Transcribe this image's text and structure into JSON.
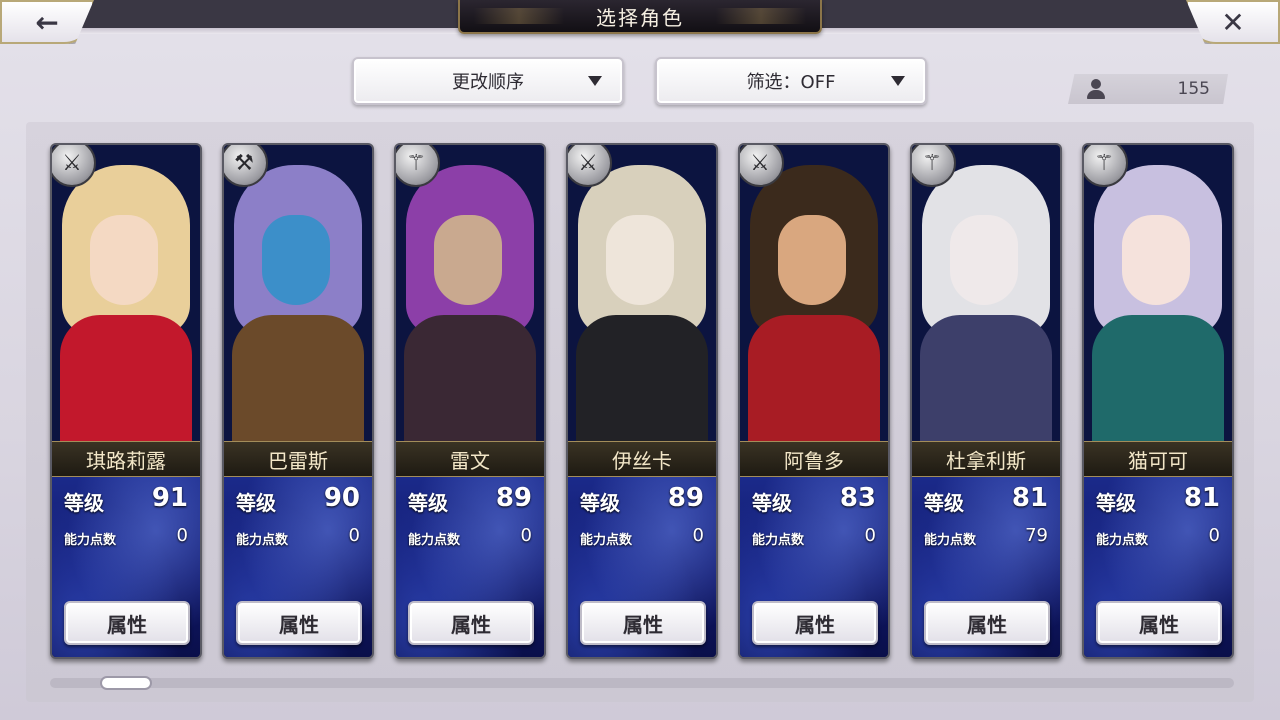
{
  "header": {
    "title": "选择角色",
    "back_icon": "←",
    "close_icon": "✕"
  },
  "controls": {
    "sort_label": "更改顺序",
    "filter_label": "筛选：OFF",
    "character_count": "155"
  },
  "card_labels": {
    "level": "等级",
    "ability_points": "能力点数",
    "attribute_button": "属性"
  },
  "characters": [
    {
      "name": "琪路莉露",
      "level": "91",
      "ability_points": "0",
      "weapon": "sword-icon",
      "weapon_glyph": "⚔",
      "hair": "#e9cf9a",
      "face": "#f4d9c3",
      "body": "#c2182c"
    },
    {
      "name": "巴雷斯",
      "level": "90",
      "ability_points": "0",
      "weapon": "axe-icon",
      "weapon_glyph": "⚒",
      "hair": "#8c7fc8",
      "face": "#3c8fc9",
      "body": "#6b4a2a"
    },
    {
      "name": "雷文",
      "level": "89",
      "ability_points": "0",
      "weapon": "staff-icon",
      "weapon_glyph": "⚚",
      "hair": "#8c3fa8",
      "face": "#c9a98f",
      "body": "#3a2834"
    },
    {
      "name": "伊丝卡",
      "level": "89",
      "ability_points": "0",
      "weapon": "blade-icon",
      "weapon_glyph": "⚔",
      "hair": "#d8d0bc",
      "face": "#eee5da",
      "body": "#222226"
    },
    {
      "name": "阿鲁多",
      "level": "83",
      "ability_points": "0",
      "weapon": "sword-icon",
      "weapon_glyph": "⚔",
      "hair": "#3b2a1c",
      "face": "#d9a77f",
      "body": "#a81c24"
    },
    {
      "name": "杜拿利斯",
      "level": "81",
      "ability_points": "79",
      "weapon": "staff-icon",
      "weapon_glyph": "⚚",
      "hair": "#e2e2e6",
      "face": "#efe9ea",
      "body": "#3d3f6a"
    },
    {
      "name": "猫可可",
      "level": "81",
      "ability_points": "0",
      "weapon": "staff-icon",
      "weapon_glyph": "⚚",
      "hair": "#c8c0e0",
      "face": "#f5e2dc",
      "body": "#1f6a6a"
    }
  ]
}
